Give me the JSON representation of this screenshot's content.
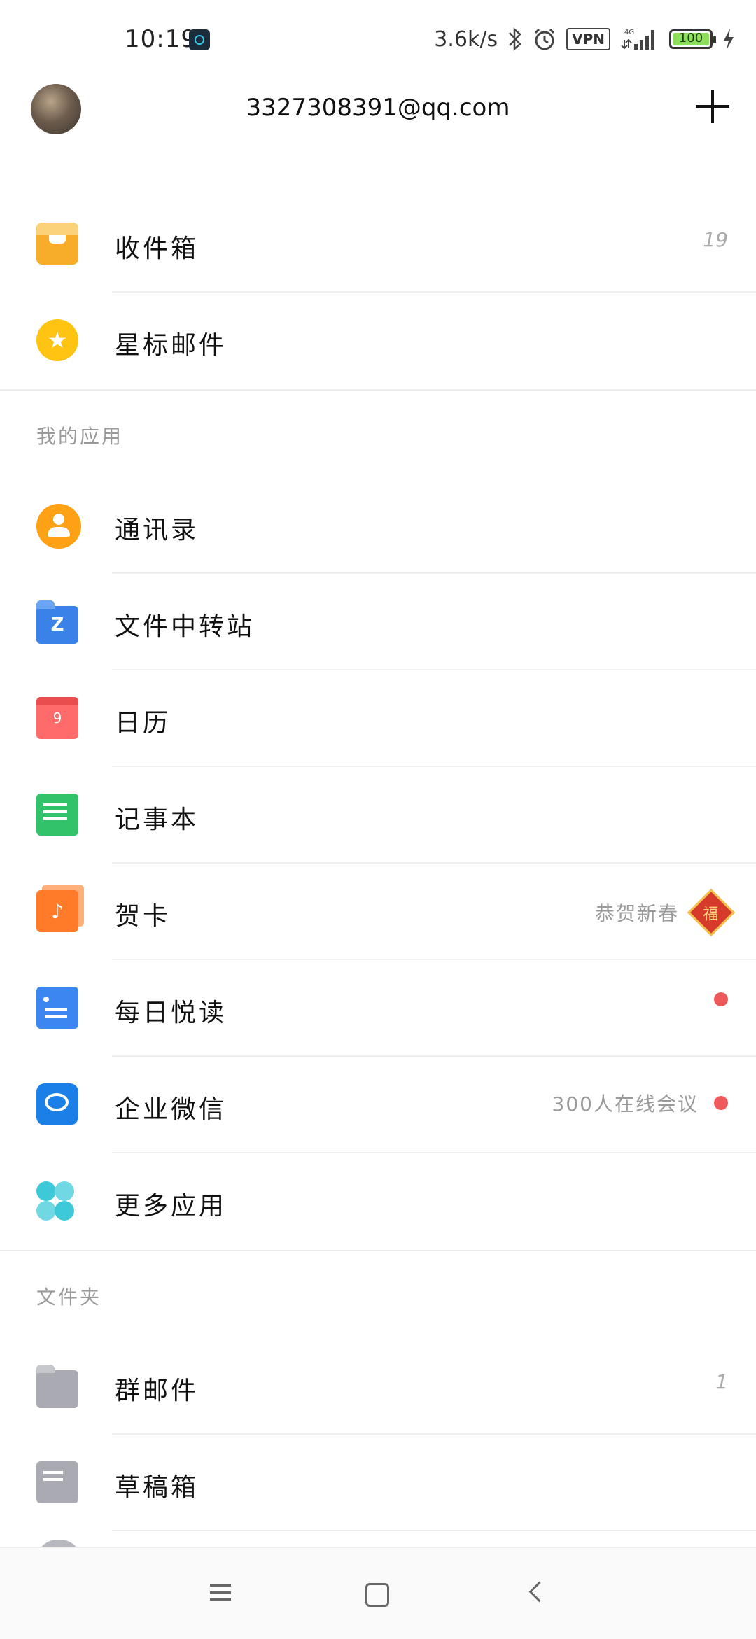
{
  "status_bar": {
    "time": "10:19",
    "network_speed": "3.6k/s",
    "vpn": "VPN",
    "network_type": "4G",
    "battery": "100"
  },
  "header": {
    "account": "3327308391@qq.com"
  },
  "mailboxes": [
    {
      "label": "收件箱",
      "count": "19",
      "icon": "inbox-icon"
    },
    {
      "label": "星标邮件",
      "icon": "star-icon"
    }
  ],
  "apps_section": {
    "title": "我的应用",
    "items": [
      {
        "label": "通讯录",
        "icon": "contacts-icon"
      },
      {
        "label": "文件中转站",
        "icon": "file-transfer-icon",
        "icon_text": "Z"
      },
      {
        "label": "日历",
        "icon": "calendar-icon",
        "icon_text": "9"
      },
      {
        "label": "记事本",
        "icon": "notepad-icon"
      },
      {
        "label": "贺卡",
        "icon": "greeting-card-icon",
        "right_text": "恭贺新春",
        "badge": "福"
      },
      {
        "label": "每日悦读",
        "icon": "daily-read-icon"
      },
      {
        "label": "企业微信",
        "icon": "wecom-icon",
        "right_text": "300人在线会议"
      },
      {
        "label": "更多应用",
        "icon": "more-apps-icon"
      }
    ]
  },
  "folders_section": {
    "title": "文件夹",
    "items": [
      {
        "label": "群邮件",
        "count": "1",
        "icon": "group-mail-folder-icon"
      },
      {
        "label": "草稿箱",
        "icon": "drafts-icon"
      }
    ]
  },
  "colors": {
    "accent_red_dot": "#f0595c",
    "inbox": "#f7ad2a",
    "star": "#ffc312",
    "contacts": "#ffa114",
    "file_transfer": "#3b82e8",
    "calendar": "#ff6b6b",
    "notepad": "#31c26a",
    "card": "#ff7a29",
    "read": "#3b86f0",
    "wecom": "#1b7fe8",
    "more": "#3ec9d8"
  }
}
